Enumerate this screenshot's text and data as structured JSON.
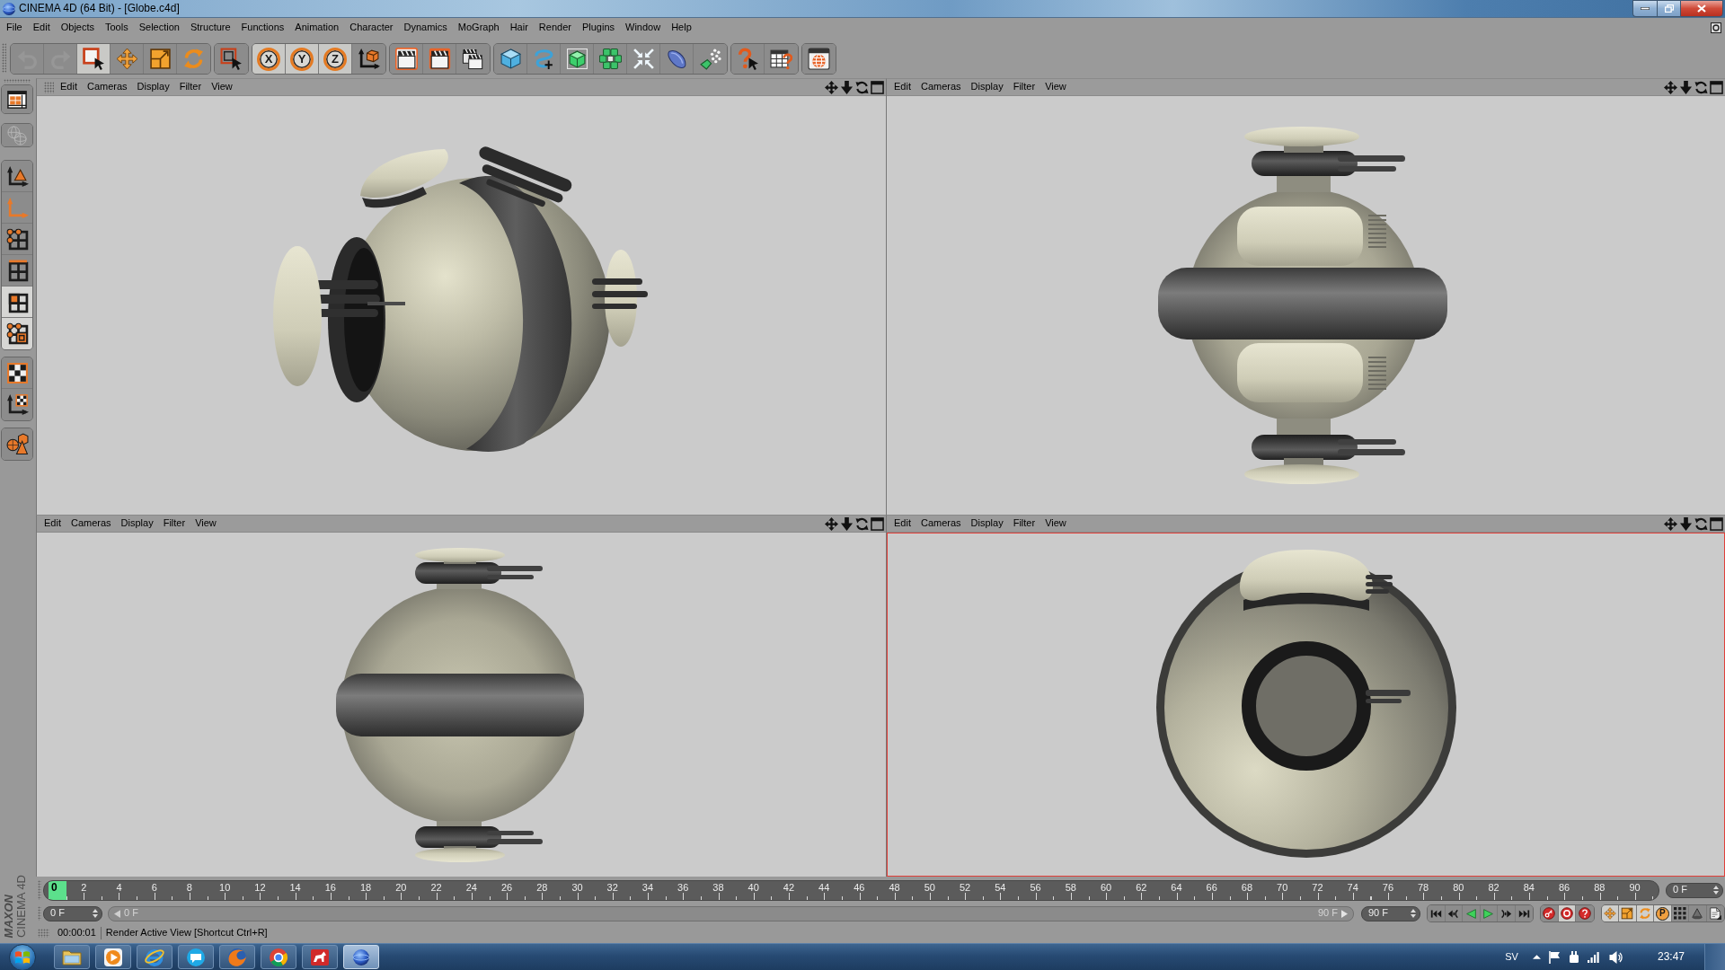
{
  "window": {
    "title": "CINEMA 4D (64 Bit) - [Globe.c4d]"
  },
  "menu": [
    "File",
    "Edit",
    "Objects",
    "Tools",
    "Selection",
    "Structure",
    "Functions",
    "Animation",
    "Character",
    "Dynamics",
    "MoGraph",
    "Hair",
    "Render",
    "Plugins",
    "Window",
    "Help"
  ],
  "toolbar": [
    [
      {
        "kind": "icon",
        "selected": false,
        "disabled": true
      },
      {
        "kind": "icon",
        "selected": false,
        "disabled": true
      },
      {
        "kind": "icon",
        "selected": true,
        "disabled": false
      },
      {
        "kind": "icon",
        "selected": false,
        "disabled": false
      },
      {
        "kind": "icon",
        "selected": false,
        "disabled": false
      },
      {
        "kind": "icon",
        "selected": false,
        "disabled": false
      }
    ],
    [
      {
        "kind": "icon",
        "selected": false,
        "disabled": false
      }
    ],
    [
      {
        "kind": "axis",
        "label": "X",
        "selected": true,
        "disabled": false
      },
      {
        "kind": "axis",
        "label": "Y",
        "selected": true,
        "disabled": false
      },
      {
        "kind": "axis",
        "label": "Z",
        "selected": true,
        "disabled": false
      },
      {
        "kind": "icon",
        "selected": false,
        "disabled": false
      }
    ],
    [
      {
        "kind": "icon",
        "selected": false,
        "disabled": false
      },
      {
        "kind": "icon",
        "selected": false,
        "disabled": false
      },
      {
        "kind": "icon",
        "selected": false,
        "disabled": false
      }
    ],
    [
      {
        "kind": "icon",
        "selected": false,
        "disabled": false
      },
      {
        "kind": "icon",
        "selected": false,
        "disabled": false
      },
      {
        "kind": "icon",
        "selected": false,
        "disabled": false
      },
      {
        "kind": "icon",
        "selected": false,
        "disabled": false
      },
      {
        "kind": "icon",
        "selected": false,
        "disabled": false
      },
      {
        "kind": "icon",
        "selected": false,
        "disabled": false
      },
      {
        "kind": "icon",
        "selected": false,
        "disabled": false
      }
    ],
    [
      {
        "kind": "icon",
        "selected": false,
        "disabled": false
      },
      {
        "kind": "icon",
        "selected": false,
        "disabled": false
      }
    ],
    [
      {
        "kind": "icon",
        "selected": false,
        "disabled": false
      }
    ]
  ],
  "palette": [
    [
      {
        "selected": false,
        "disabled": false
      }
    ],
    [
      {
        "selected": false,
        "disabled": true
      }
    ],
    [
      {
        "selected": false,
        "disabled": false
      },
      {
        "selected": false,
        "disabled": false
      },
      {
        "selected": false,
        "disabled": false
      },
      {
        "selected": false,
        "disabled": false
      },
      {
        "selected": true,
        "disabled": false
      },
      {
        "selected": true,
        "disabled": false
      }
    ],
    [
      {
        "selected": false,
        "disabled": false
      },
      {
        "selected": false,
        "disabled": false
      }
    ],
    [
      {
        "selected": false,
        "disabled": false
      }
    ]
  ],
  "viewports": [
    {
      "kind": "perspective",
      "selected": false,
      "menu": [
        "Edit",
        "Cameras",
        "Display",
        "Filter",
        "View"
      ]
    },
    {
      "kind": "top",
      "selected": false,
      "menu": [
        "Edit",
        "Cameras",
        "Display",
        "Filter",
        "View"
      ]
    },
    {
      "kind": "side",
      "selected": false,
      "menu": [
        "Edit",
        "Cameras",
        "Display",
        "Filter",
        "View"
      ]
    },
    {
      "kind": "front",
      "selected": true,
      "menu": [
        "Edit",
        "Cameras",
        "Display",
        "Filter",
        "View"
      ]
    }
  ],
  "timeline": {
    "playhead": "0",
    "ticks": [
      "2",
      "4",
      "6",
      "8",
      "10",
      "12",
      "14",
      "16",
      "18",
      "20",
      "22",
      "24",
      "26",
      "28",
      "30",
      "32",
      "34",
      "36",
      "38",
      "40",
      "42",
      "44",
      "46",
      "48",
      "50",
      "52",
      "54",
      "56",
      "58",
      "60",
      "62",
      "64",
      "66",
      "68",
      "70",
      "72",
      "74",
      "76",
      "78",
      "80",
      "82",
      "84",
      "86",
      "88",
      "90"
    ],
    "frame": "0 F"
  },
  "range": {
    "start": "0 F",
    "slider_start": "0 F",
    "slider_end": "90 F",
    "end": "90 F"
  },
  "record": [
    {
      "selected": false
    },
    {
      "selected": true
    },
    {
      "selected": false
    }
  ],
  "keys": [
    {
      "kind": "icon",
      "selected": true
    },
    {
      "kind": "icon",
      "selected": true
    },
    {
      "kind": "icon",
      "selected": true
    },
    {
      "kind": "letter",
      "label": "P",
      "selected": true
    },
    {
      "kind": "icon",
      "selected": false
    },
    {
      "kind": "icon",
      "selected": false
    },
    {
      "kind": "icon",
      "selected": false
    }
  ],
  "status_bar": {
    "time": "00:00:01",
    "message": "Render Active View [Shortcut Ctrl+R]"
  },
  "logo": {
    "brand": "MAXON",
    "product": "CINEMA 4D"
  },
  "taskbar": {
    "apps": [
      {
        "selected": false
      },
      {
        "selected": false
      },
      {
        "selected": false
      },
      {
        "selected": false
      },
      {
        "selected": false
      },
      {
        "selected": false
      },
      {
        "selected": false
      },
      {
        "selected": true
      }
    ],
    "language": "SV",
    "clock": "23:47"
  }
}
